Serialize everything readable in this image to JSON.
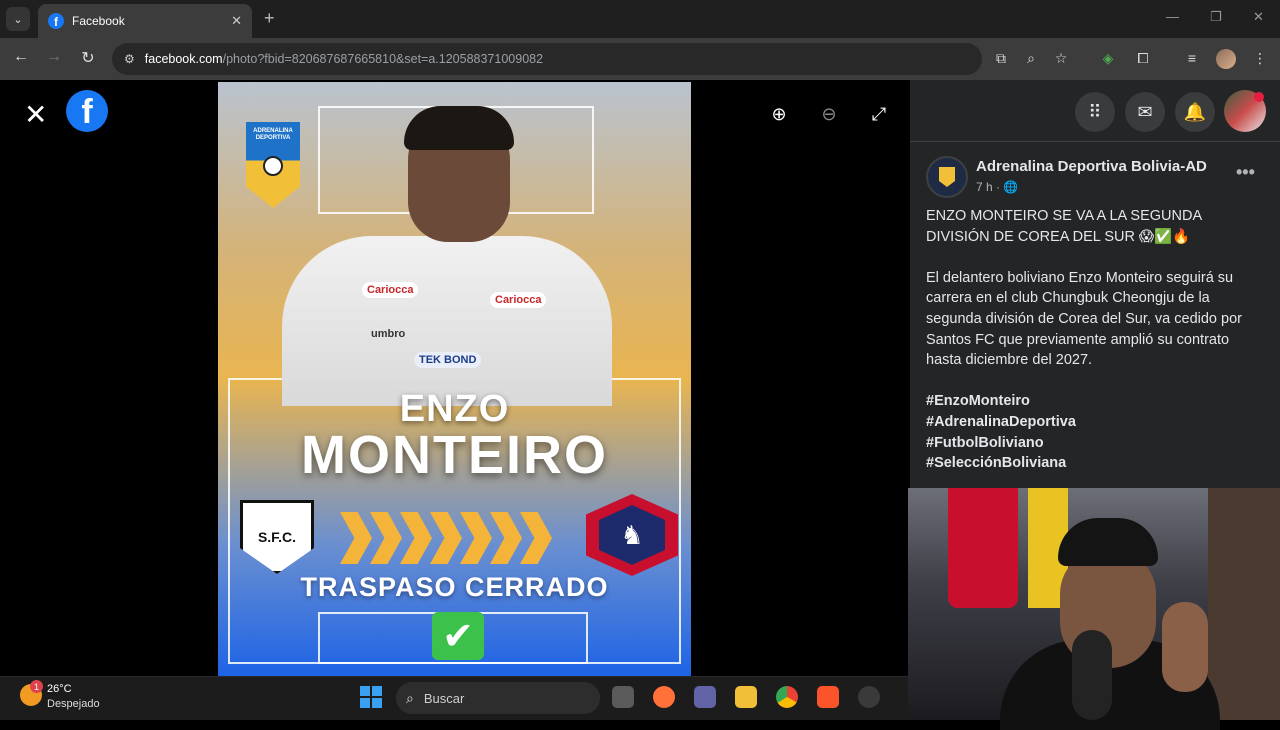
{
  "browser": {
    "tab_title": "Facebook",
    "tab_favicon_letter": "f",
    "url_host": "facebook.com",
    "url_path": "/photo?fbid=820687687665810&set=a.120588371009082"
  },
  "viewer": {
    "close_glyph": "✕",
    "fb_logo_letter": "f",
    "zoom_in_glyph": "⊕",
    "zoom_out_glyph": "⊖",
    "fullscreen_glyph": "⤢"
  },
  "poster": {
    "badge_text": "ADRENALINA DEPORTIVA",
    "name_first": "ENZO",
    "name_last": "MONTEIRO",
    "status": "TRASPASO CERRADO",
    "origin_club_abbr": "S.F.C.",
    "sponsor_1": "Cariocca",
    "sponsor_2": "Cariocca",
    "sponsor_3": "umbro",
    "sponsor_4": "TEK BOND",
    "check_glyph": "✔"
  },
  "post": {
    "page_name": "Adrenalina Deportiva Bolivia-AD",
    "time": "7 h · ",
    "headline": "ENZO MONTEIRO SE VA A LA SEGUNDA DIVISIÓN DE COREA DEL SUR 😱✅🔥",
    "body": "El delantero boliviano Enzo Monteiro seguirá su carrera en el club Chungbuk Cheongju de la segunda división de Corea del Sur, va cedido por Santos FC que previamente amplió su contrato hasta diciembre del 2027.",
    "hashtags": [
      "#EnzoMonteiro",
      "#AdrenalinaDeportiva",
      "#FutbolBoliviano",
      "#SelecciónBoliviana"
    ],
    "more_glyph": "•••"
  },
  "taskbar": {
    "weather_badge": "1",
    "temperature": "26°C",
    "condition": "Despejado",
    "search_label": "Buscar"
  },
  "colors": {
    "fb_blue": "#1877f2",
    "panel_bg": "#242526",
    "accent_gold": "#f4b43a",
    "check_green": "#3cc24a"
  }
}
